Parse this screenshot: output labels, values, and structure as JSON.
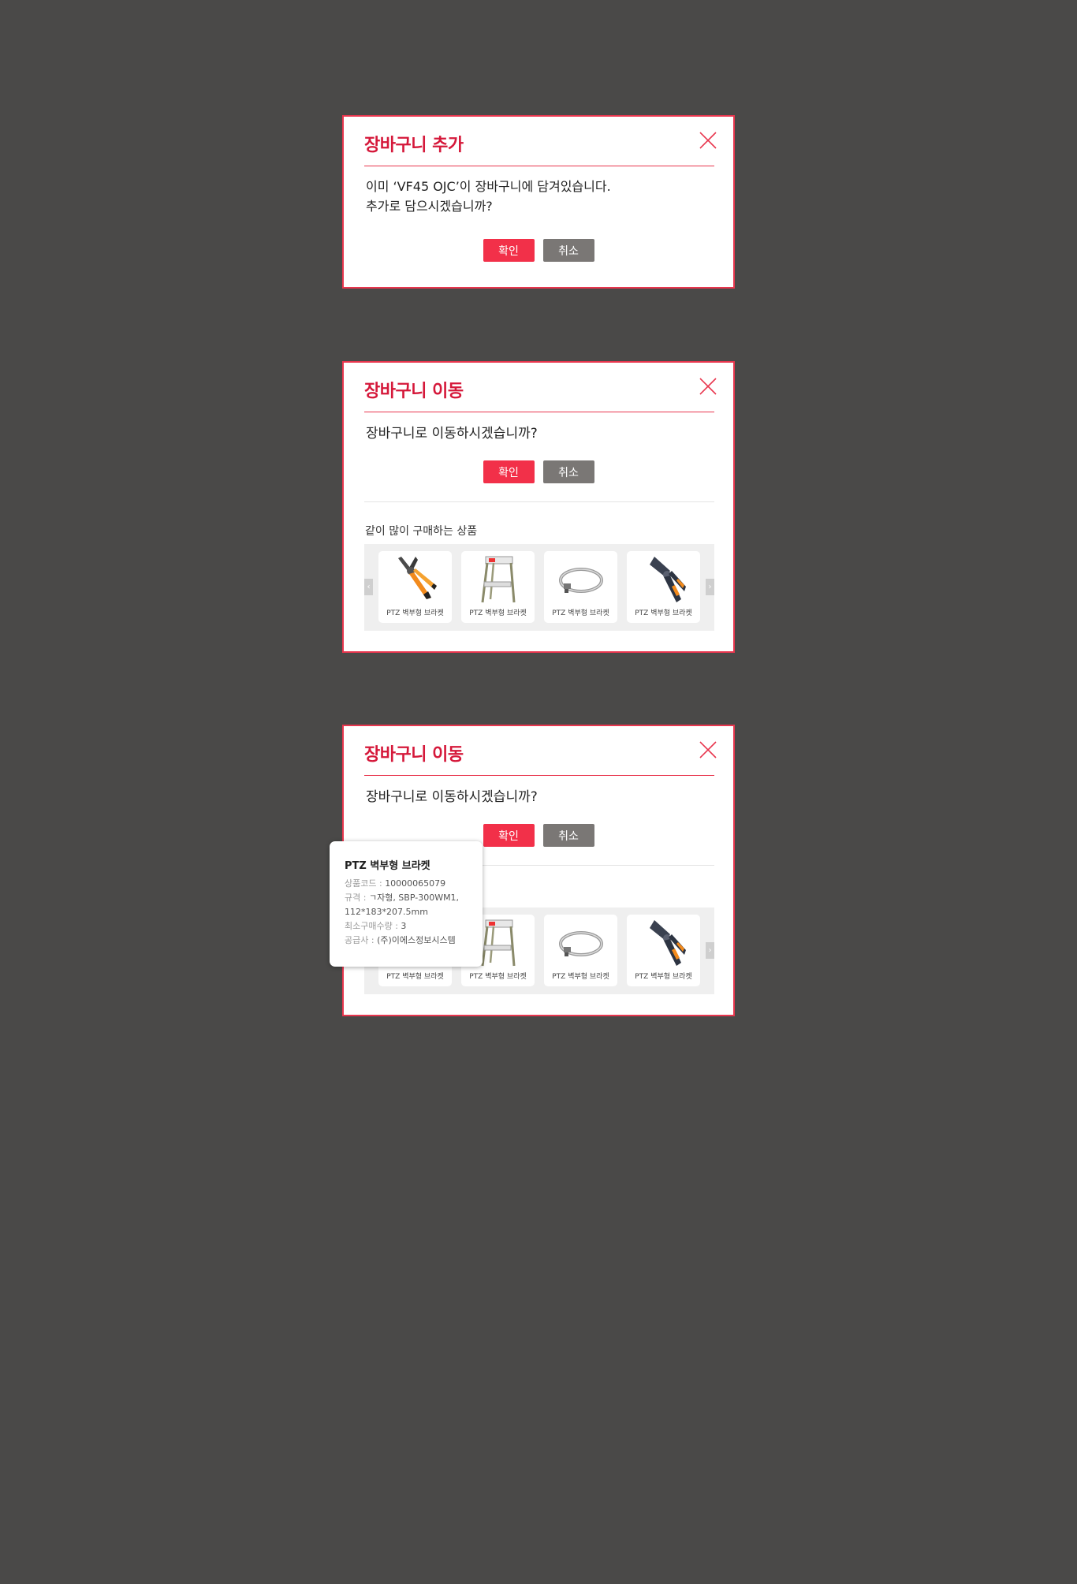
{
  "colors": {
    "accent": "#e8364e",
    "title": "#d5183a",
    "confirm": "#f23049",
    "cancel": "#7a7775",
    "backdrop": "#4a4948"
  },
  "icons": {
    "close": "close-icon",
    "prev": "chevron-left-icon",
    "next": "chevron-right-icon"
  },
  "modal_add": {
    "title": "장바구니 추가",
    "message_line1": "이미 ‘VF45 OJC’이 장바구니에 담겨있습니다.",
    "message_line2": "추가로 담으시겠습니까?",
    "confirm_label": "확인",
    "cancel_label": "취소"
  },
  "modal_move": {
    "title": "장바구니 이동",
    "message": "장바구니로 이동하시겠습니까?",
    "confirm_label": "확인",
    "cancel_label": "취소",
    "related_title": "같이 많이 구매하는 상품",
    "products": [
      {
        "name": "PTZ 벽부형 브라켓",
        "image": "crimp-pliers-orange"
      },
      {
        "name": "PTZ 벽부형 브라켓",
        "image": "step-stool"
      },
      {
        "name": "PTZ 벽부형 브라켓",
        "image": "hose-clamp"
      },
      {
        "name": "PTZ 벽부형 브라켓",
        "image": "crimp-tool-dark"
      }
    ]
  },
  "tooltip": {
    "title": "PTZ 벽부형 브라켓",
    "code_label": "상품코드 : ",
    "code_value": "10000065079",
    "spec_label": "규격 : ",
    "spec_value": "ㄱ자형, SBP-300WM1,",
    "spec_value2": "112*183*207.5mm",
    "min_qty_label": "최소구매수량 : ",
    "min_qty_value": "3",
    "supplier_label": "공급사 : ",
    "supplier_value": "(주)이에스정보시스템"
  }
}
